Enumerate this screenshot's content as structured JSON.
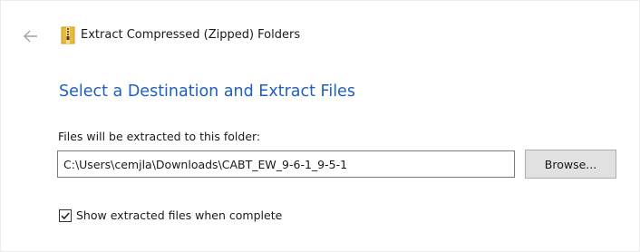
{
  "window": {
    "title": "Extract Compressed (Zipped) Folders",
    "back_icon": "arrow-left-icon",
    "app_icon": "zip-folder-icon"
  },
  "main": {
    "heading": "Select a Destination and Extract Files",
    "destination_label": "Files will be extracted to this folder:",
    "destination_value": "C:\\Users\\cemjla\\Downloads\\CABT_EW_9-6-1_9-5-1",
    "browse_label": "Browse...",
    "show_files_checked": true,
    "show_files_label": "Show extracted files when complete"
  },
  "colors": {
    "heading": "#1f5fbf",
    "button_bg": "#e1e1e1",
    "folder_yellow": "#e8b93c"
  }
}
